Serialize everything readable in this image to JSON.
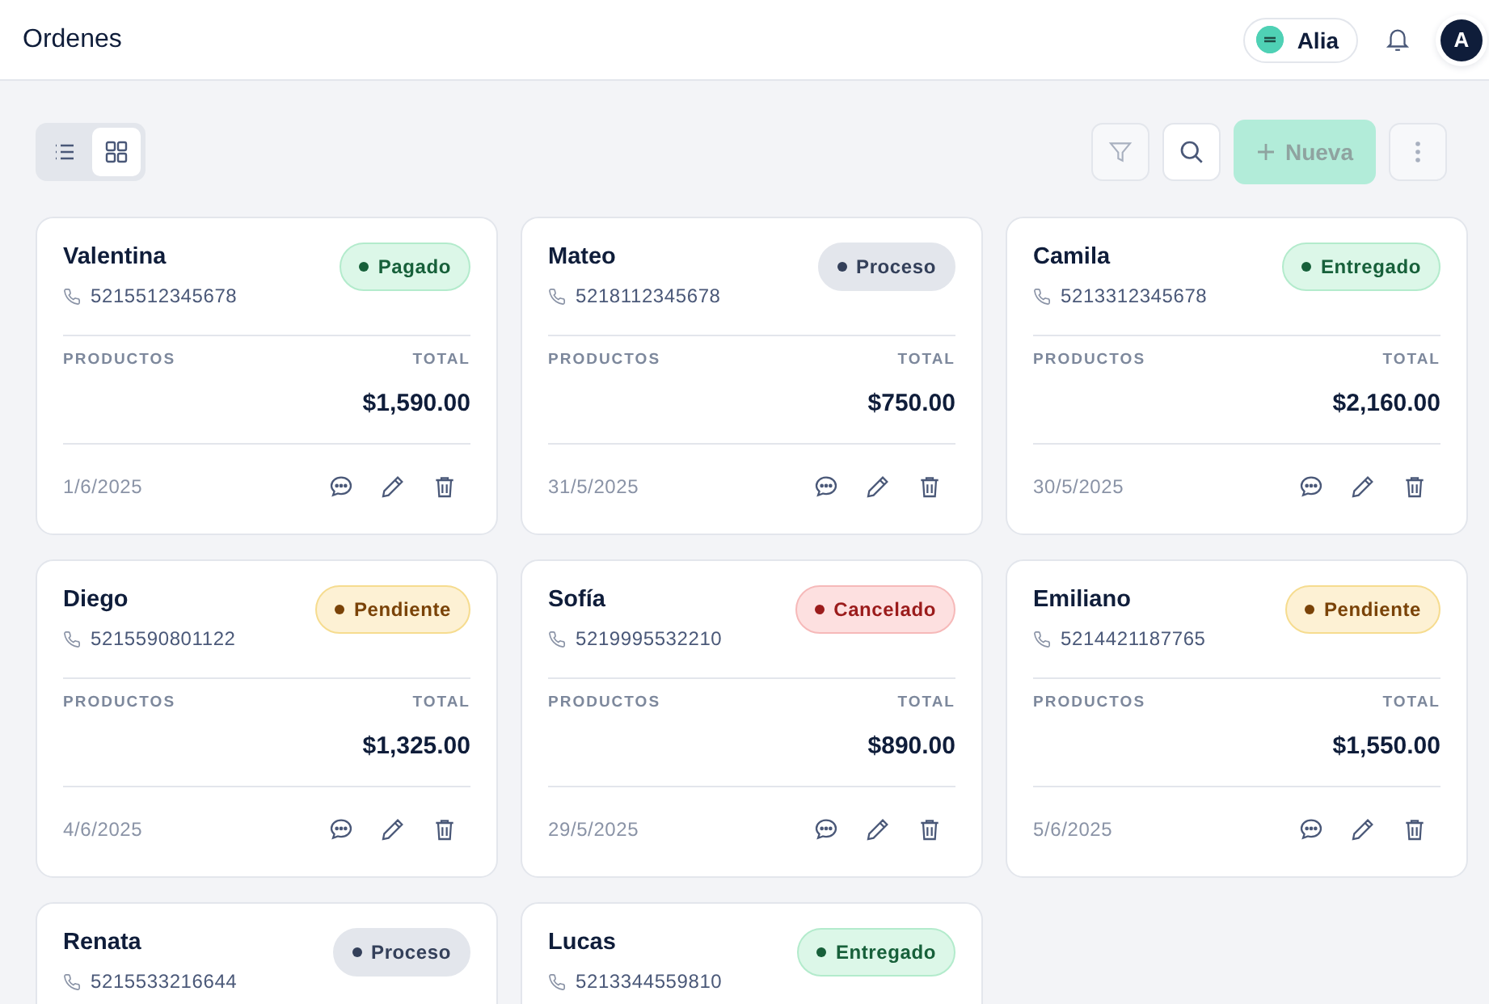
{
  "header": {
    "title": "Ordenes",
    "workspace": {
      "name": "Alia"
    },
    "user": {
      "initial": "A"
    }
  },
  "toolbar": {
    "view_options": [
      {
        "kind": "list",
        "selected": false
      },
      {
        "kind": "grid",
        "selected": true
      }
    ],
    "new_button": {
      "label": "Nueva",
      "disabled": true
    }
  },
  "orders": [
    {
      "name": "Valentina",
      "phone": "5215512345678",
      "status": {
        "label": "Pagado",
        "kind": "paid"
      },
      "products_label": "PRODUCTOS",
      "total_label": "TOTAL",
      "total": "$1,590.00",
      "date": "1/6/2025"
    },
    {
      "name": "Mateo",
      "phone": "5218112345678",
      "status": {
        "label": "Proceso",
        "kind": "process"
      },
      "products_label": "PRODUCTOS",
      "total_label": "TOTAL",
      "total": "$750.00",
      "date": "31/5/2025"
    },
    {
      "name": "Camila",
      "phone": "5213312345678",
      "status": {
        "label": "Entregado",
        "kind": "delivered"
      },
      "products_label": "PRODUCTOS",
      "total_label": "TOTAL",
      "total": "$2,160.00",
      "date": "30/5/2025"
    },
    {
      "name": "Diego",
      "phone": "5215590801122",
      "status": {
        "label": "Pendiente",
        "kind": "pending"
      },
      "products_label": "PRODUCTOS",
      "total_label": "TOTAL",
      "total": "$1,325.00",
      "date": "4/6/2025"
    },
    {
      "name": "Sofía",
      "phone": "5219995532210",
      "status": {
        "label": "Cancelado",
        "kind": "cancelled"
      },
      "products_label": "PRODUCTOS",
      "total_label": "TOTAL",
      "total": "$890.00",
      "date": "29/5/2025"
    },
    {
      "name": "Emiliano",
      "phone": "5214421187765",
      "status": {
        "label": "Pendiente",
        "kind": "pending"
      },
      "products_label": "PRODUCTOS",
      "total_label": "TOTAL",
      "total": "$1,550.00",
      "date": "5/6/2025"
    },
    {
      "name": "Renata",
      "phone": "5215533216644",
      "status": {
        "label": "Proceso",
        "kind": "process"
      }
    },
    {
      "name": "Lucas",
      "phone": "5213344559810",
      "status": {
        "label": "Entregado",
        "kind": "delivered"
      }
    }
  ]
}
